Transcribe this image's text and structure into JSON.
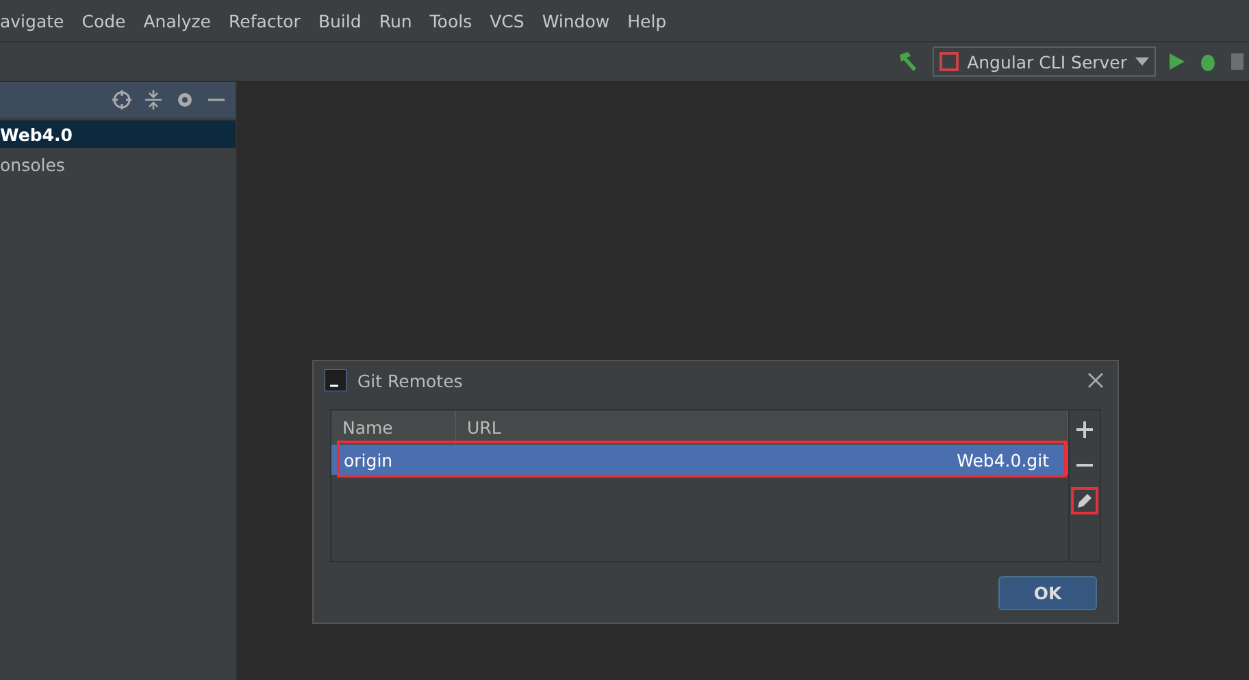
{
  "menu": [
    "avigate",
    "Code",
    "Analyze",
    "Refactor",
    "Build",
    "Run",
    "Tools",
    "VCS",
    "Window",
    "Help"
  ],
  "toolbar": {
    "run_config": "Angular CLI Server"
  },
  "project_panel": {
    "items": [
      {
        "label": "Web4.0",
        "selected": true
      },
      {
        "label": "onsoles",
        "selected": false
      }
    ]
  },
  "dialog": {
    "title": "Git Remotes",
    "columns": [
      "Name",
      "URL"
    ],
    "rows": [
      {
        "name": "origin",
        "url": "Web4.0.git",
        "selected": true,
        "highlighted": true
      }
    ],
    "edit_highlighted": true,
    "ok": "OK"
  }
}
